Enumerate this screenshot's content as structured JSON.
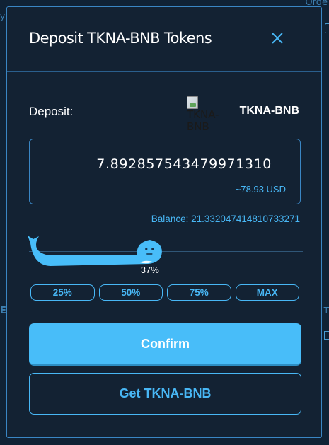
{
  "background": {
    "top_right_text": "Orde",
    "left_fragment_top": "y",
    "left_fragment_mid": "E",
    "right_fragment_mid": "T"
  },
  "modal": {
    "title": "Deposit TKNA-BNB Tokens",
    "close_icon": "close-icon",
    "deposit_label": "Deposit:",
    "token_image_alt": "TKNA-BNB",
    "token_symbol": "TKNA-BNB",
    "amount": "7.892857543479971310",
    "amount_usd": "~78.93 USD",
    "balance_text": "Balance: 21.332047414810733271",
    "slider": {
      "percent_value": 37,
      "percent_label": "37%",
      "handle_icon": "whale-icon"
    },
    "presets": [
      "25%",
      "50%",
      "75%",
      "MAX"
    ],
    "confirm_label": "Confirm",
    "get_token_label": "Get TKNA-BNB"
  },
  "colors": {
    "accent": "#48b7f5",
    "background": "#132233",
    "border": "#3a86c4"
  }
}
